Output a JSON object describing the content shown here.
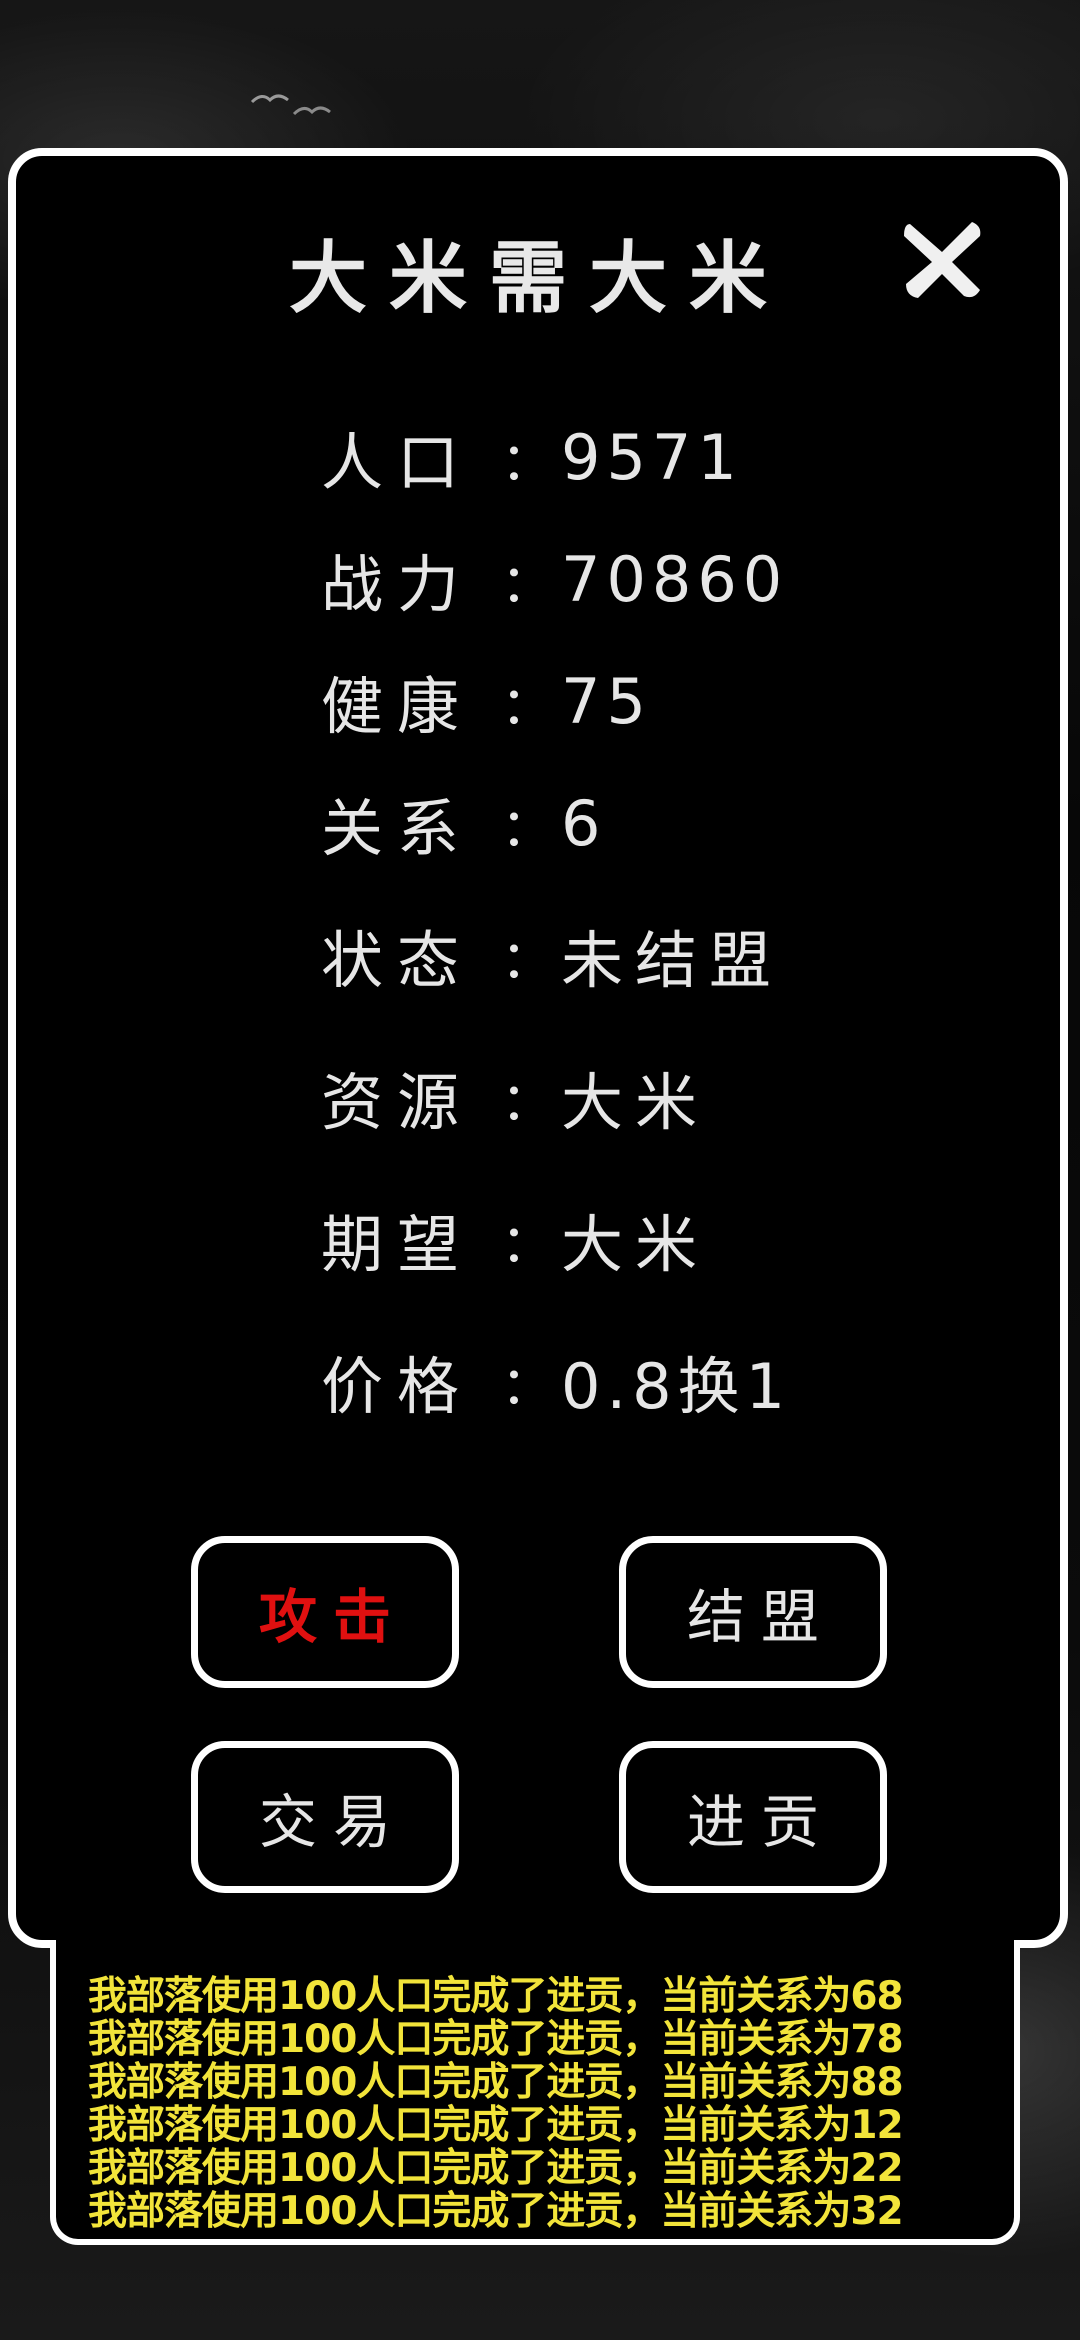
{
  "dialog": {
    "title": "大米需大米",
    "stats": [
      {
        "label": "人口",
        "colon": "：",
        "value": "9571"
      },
      {
        "label": "战力",
        "colon": "：",
        "value": "70860"
      },
      {
        "label": "健康",
        "colon": "：",
        "value": "75"
      },
      {
        "label": "关系",
        "colon": "：",
        "value": "6"
      },
      {
        "label": "状态",
        "colon": "：",
        "value": "未结盟"
      },
      {
        "label": "资源",
        "colon": "：",
        "value": "大米"
      },
      {
        "label": "期望",
        "colon": "：",
        "value": "大米"
      },
      {
        "label": "价格",
        "colon": "：",
        "value": "0.8换1"
      }
    ],
    "buttons": {
      "attack": "攻击",
      "alliance": "结盟",
      "trade": "交易",
      "tribute": "进贡"
    }
  },
  "log": [
    "我部落使用100人口完成了进贡，当前关系为68",
    "我部落使用100人口完成了进贡，当前关系为78",
    "我部落使用100人口完成了进贡，当前关系为88",
    "我部落使用100人口完成了进贡，当前关系为12",
    "我部落使用100人口完成了进贡，当前关系为22",
    "我部落使用100人口完成了进贡，当前关系为32"
  ],
  "colors": {
    "attack": "#e01010",
    "log_text": "#f2e43a",
    "border": "#ffffff"
  },
  "icons": {
    "close": "close-icon",
    "decoration": "birds-icon"
  }
}
